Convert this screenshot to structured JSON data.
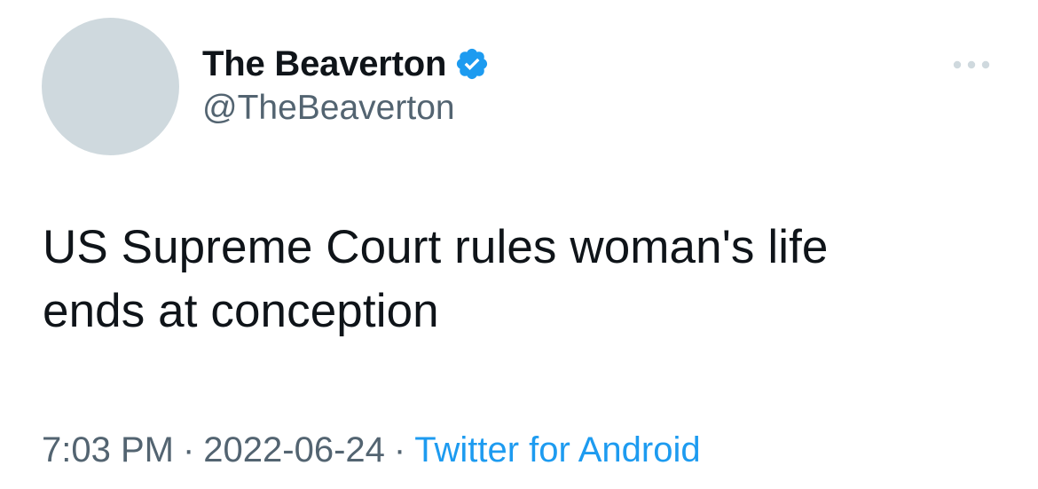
{
  "tweet": {
    "author": {
      "display_name": "The Beaverton",
      "handle": "@TheBeaverton",
      "verified_icon": "verified-badge-icon",
      "avatar_color": "#cfd9de"
    },
    "more_icon": "more-horizontal-icon",
    "text_lines": [
      "US Supreme Court rules woman's life",
      "ends at conception"
    ],
    "time": "7:03 PM",
    "separator": "·",
    "date": "2022-06-24",
    "source": "Twitter for Android"
  },
  "colors": {
    "primary_text": "#0f1419",
    "secondary_text": "#536471",
    "accent": "#1d9bf0",
    "avatar_placeholder": "#cfd9de"
  }
}
